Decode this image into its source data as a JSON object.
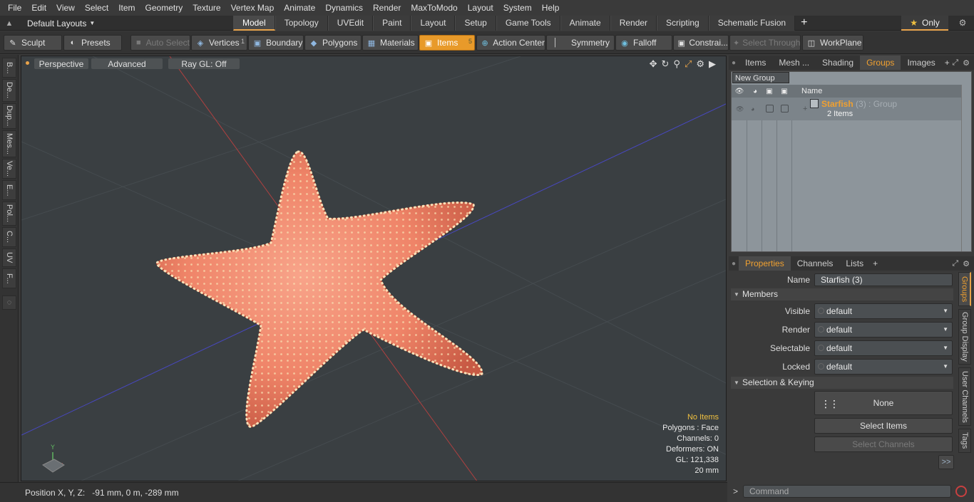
{
  "menu": [
    "File",
    "Edit",
    "View",
    "Select",
    "Item",
    "Geometry",
    "Texture",
    "Vertex Map",
    "Animate",
    "Dynamics",
    "Render",
    "MaxToModo",
    "Layout",
    "System",
    "Help"
  ],
  "layouts": {
    "label": "Default Layouts"
  },
  "tabs": [
    "Model",
    "Topology",
    "UVEdit",
    "Paint",
    "Layout",
    "Setup",
    "Game Tools",
    "Animate",
    "Render",
    "Scripting",
    "Schematic Fusion"
  ],
  "active_tab": "Model",
  "only_button": "Only",
  "toolbar": {
    "sculpt": "Sculpt",
    "presets": "Presets",
    "auto_select": "Auto Select",
    "vertices": "Vertices",
    "vertices_count": "1",
    "boundary": "Boundary",
    "polygons": "Polygons",
    "materials": "Materials",
    "items": "Items",
    "items_count": "5",
    "action_center": "Action Center",
    "symmetry": "Symmetry",
    "falloff": "Falloff",
    "constraints": "Constrai...",
    "select_through": "Select Through",
    "workplane": "WorkPlane"
  },
  "left_strip": [
    "B...",
    "De...",
    "Dup...",
    "Mes...",
    "Ve...",
    "E...",
    "Pol...",
    "C...",
    "UV",
    "F..."
  ],
  "viewport": {
    "view": "Perspective",
    "mode": "Advanced",
    "raygl": "Ray GL: Off",
    "stats": {
      "no_items": "No Items",
      "polygons": "Polygons : Face",
      "channels": "Channels: 0",
      "deformers": "Deformers: ON",
      "gl": "GL: 121,338",
      "scale": "20 mm"
    }
  },
  "status": {
    "label": "Position X, Y, Z:",
    "value": "-91 mm, 0 m, -289 mm"
  },
  "top_panel_tabs": [
    "Items",
    "Mesh ...",
    "Shading",
    "Groups",
    "Images"
  ],
  "top_panel_active": "Groups",
  "groups": {
    "new_group": "New Group",
    "column_name": "Name",
    "row": {
      "name": "Starfish",
      "count": "(3)",
      "type": ": Group",
      "items": "2 Items"
    }
  },
  "bottom_panel_tabs": [
    "Properties",
    "Channels",
    "Lists"
  ],
  "bottom_panel_active": "Properties",
  "properties": {
    "name_label": "Name",
    "name_value": "Starfish (3)",
    "members_section": "Members",
    "fields": [
      {
        "label": "Visible",
        "value": "default"
      },
      {
        "label": "Render",
        "value": "default"
      },
      {
        "label": "Selectable",
        "value": "default"
      },
      {
        "label": "Locked",
        "value": "default"
      }
    ],
    "selection_section": "Selection & Keying",
    "none_button": "None",
    "select_items": "Select Items",
    "select_channels": "Select Channels",
    "more": ">>"
  },
  "side_tabs": [
    "Groups",
    "Group Display",
    "User Channels",
    "Tags"
  ],
  "command_placeholder": "Command",
  "colors": {
    "accent": "#e89a2a",
    "starfish": "#f08a6a",
    "viewport_bg": "#3a3f42"
  }
}
